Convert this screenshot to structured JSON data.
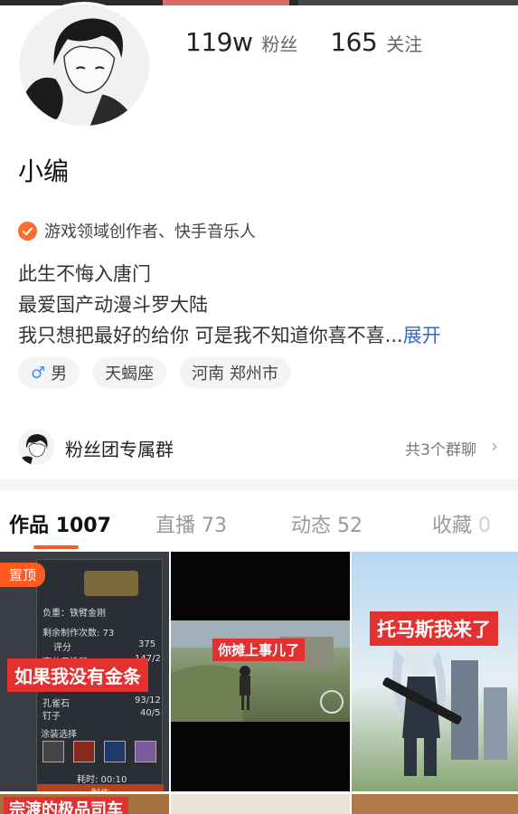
{
  "profile": {
    "name": "小编",
    "stats": [
      {
        "value": "119w",
        "label": "粉丝"
      },
      {
        "value": "165",
        "label": "关注"
      }
    ],
    "certification": "游戏领域创作者、快手音乐人",
    "bio": {
      "line1": "此生不悔入唐门",
      "line2": "最爱国产动漫斗罗大陆",
      "line3": "我只想把最好的给你 可是我不知道你喜不喜...",
      "expand_label": "展开"
    },
    "tags": {
      "gender": "男",
      "zodiac": "天蝎座",
      "location": "河南 郑州市"
    }
  },
  "fan_group": {
    "title": "粉丝团专属群",
    "count_label": "共3个群聊"
  },
  "tabs": [
    {
      "label": "作品",
      "count": "1007"
    },
    {
      "label": "直播",
      "count": "73"
    },
    {
      "label": "动态",
      "count": "52"
    },
    {
      "label": "收藏",
      "count": "0"
    }
  ],
  "works": [
    {
      "badge": "置顶",
      "caption": "如果我没有金条"
    },
    {
      "caption": "你摊上事儿了"
    },
    {
      "caption": "托马斯我来了"
    }
  ],
  "work1_panel": {
    "title": "负重：铁臂金刚",
    "remaining": "剩余制作次数: 73",
    "rating_label": "评分",
    "rating_value": "375",
    "row2_label": "高分子涂层",
    "row2_value": "147/2",
    "row3_label": "孔雀石",
    "row3_value": "93/12",
    "row4_label": "钉子",
    "row4_value": "40/5",
    "paint_label": "涂装选择",
    "time_label": "耗时: 00:10",
    "make_label": "制作"
  },
  "row2_caption": "宗渡的极品司车",
  "colors": {
    "accent": "#ff5a1f",
    "link": "#2f6cc7",
    "caption_red": "#e53030",
    "cert_orange": "#ff6b2c",
    "male_blue": "#3b8cf3"
  },
  "icons": {
    "certification": "check-badge-icon",
    "gender": "male-icon",
    "chevron": "chevron-right-icon"
  }
}
